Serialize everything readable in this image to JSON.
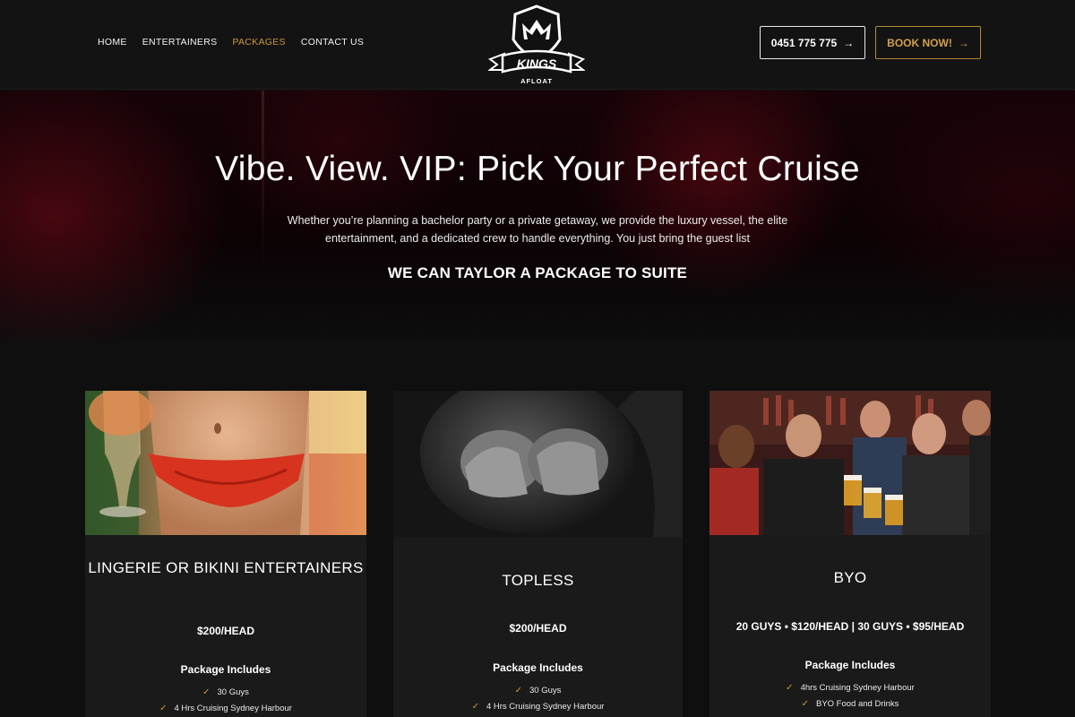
{
  "nav": {
    "items": [
      {
        "label": "HOME",
        "active": false
      },
      {
        "label": "ENTERTAINERS",
        "active": false
      },
      {
        "label": "PACKAGES",
        "active": true
      },
      {
        "label": "CONTACT US",
        "active": false
      }
    ]
  },
  "logo": {
    "name": "KINGS",
    "sub": "AFLOAT"
  },
  "header_buttons": {
    "phone_label": "0451 775 775",
    "book_label": "BOOK NOW!"
  },
  "hero": {
    "title": "Vibe. View. VIP: Pick Your Perfect Cruise",
    "description": "Whether you’re planning a bachelor party or a private getaway, we provide the luxury vessel, the elite entertainment, and a dedicated crew to handle everything. You just bring the guest list",
    "subheading": "WE CAN TAYLOR A PACKAGE TO SUITE"
  },
  "packages": [
    {
      "title": "LINGERIE OR BIKINI ENTERTAINERS",
      "price": "$200/HEAD",
      "includes_heading": "Package Includes",
      "items": [
        "30 Guys",
        "4 Hrs Cruising Sydney Harbour"
      ]
    },
    {
      "title": "TOPLESS",
      "price": "$200/HEAD",
      "includes_heading": "Package Includes",
      "items": [
        "30 Guys",
        "4 Hrs Cruising Sydney Harbour"
      ]
    },
    {
      "title": "BYO",
      "price": "20 GUYS • $120/HEAD | 30 GUYS • $95/HEAD",
      "includes_heading": "Package Includes",
      "items": [
        "4hrs Cruising Sydney Harbour",
        "BYO Food and Drinks"
      ]
    }
  ],
  "colors": {
    "accent": "#c9973a",
    "background": "#0f0f10",
    "card": "#1a1a1b",
    "header": "#131313"
  }
}
